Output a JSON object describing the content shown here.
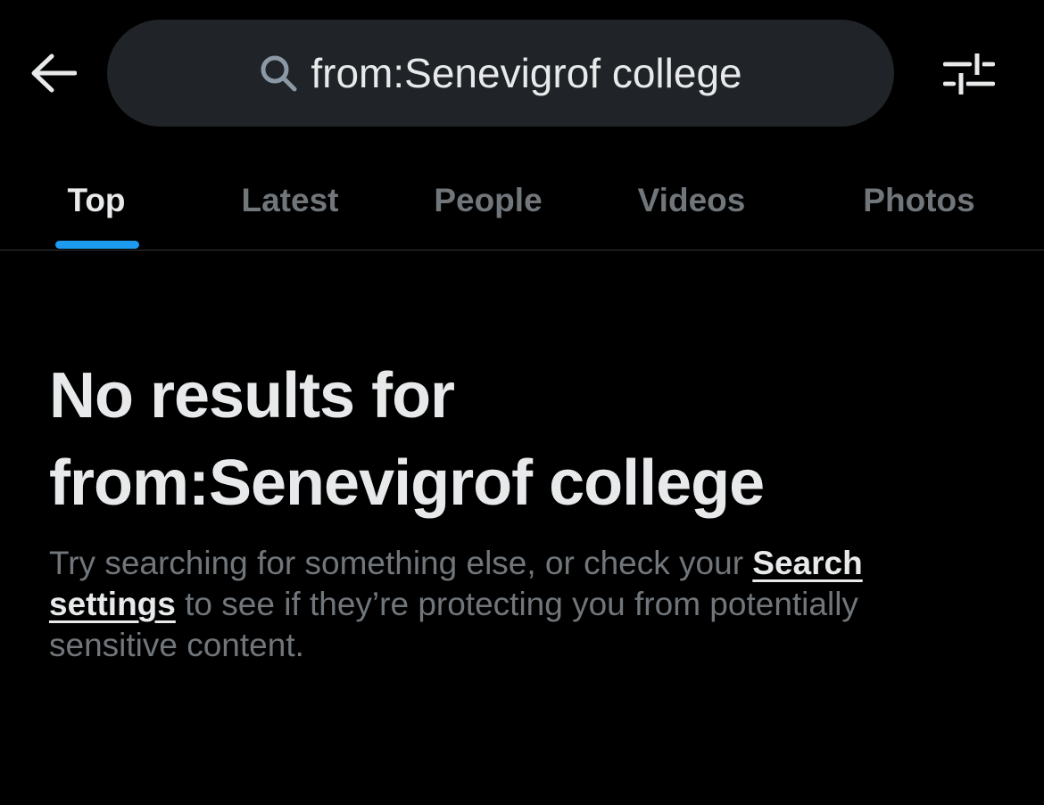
{
  "header": {
    "back_icon": "arrow-left-icon",
    "search": {
      "icon": "search-icon",
      "value": "from:Senevigrof college"
    },
    "filter_icon": "sliders-icon"
  },
  "tabs": [
    {
      "label": "Top",
      "active": true
    },
    {
      "label": "Latest",
      "active": false
    },
    {
      "label": "People",
      "active": false
    },
    {
      "label": "Videos",
      "active": false
    },
    {
      "label": "Photos",
      "active": false
    }
  ],
  "empty_state": {
    "title_line1": "No results for",
    "title_line2": "from:Senevigrof college",
    "desc_before": "Try searching for something else, or check your ",
    "link_label": "Search settings",
    "desc_after": " to see if they’re protecting you from potentially sensitive content."
  },
  "colors": {
    "background": "#000000",
    "search_pill": "#202327",
    "text_primary": "#e7e9ea",
    "text_secondary": "#71767b",
    "accent": "#1d9bf0",
    "divider": "#2f3336"
  }
}
